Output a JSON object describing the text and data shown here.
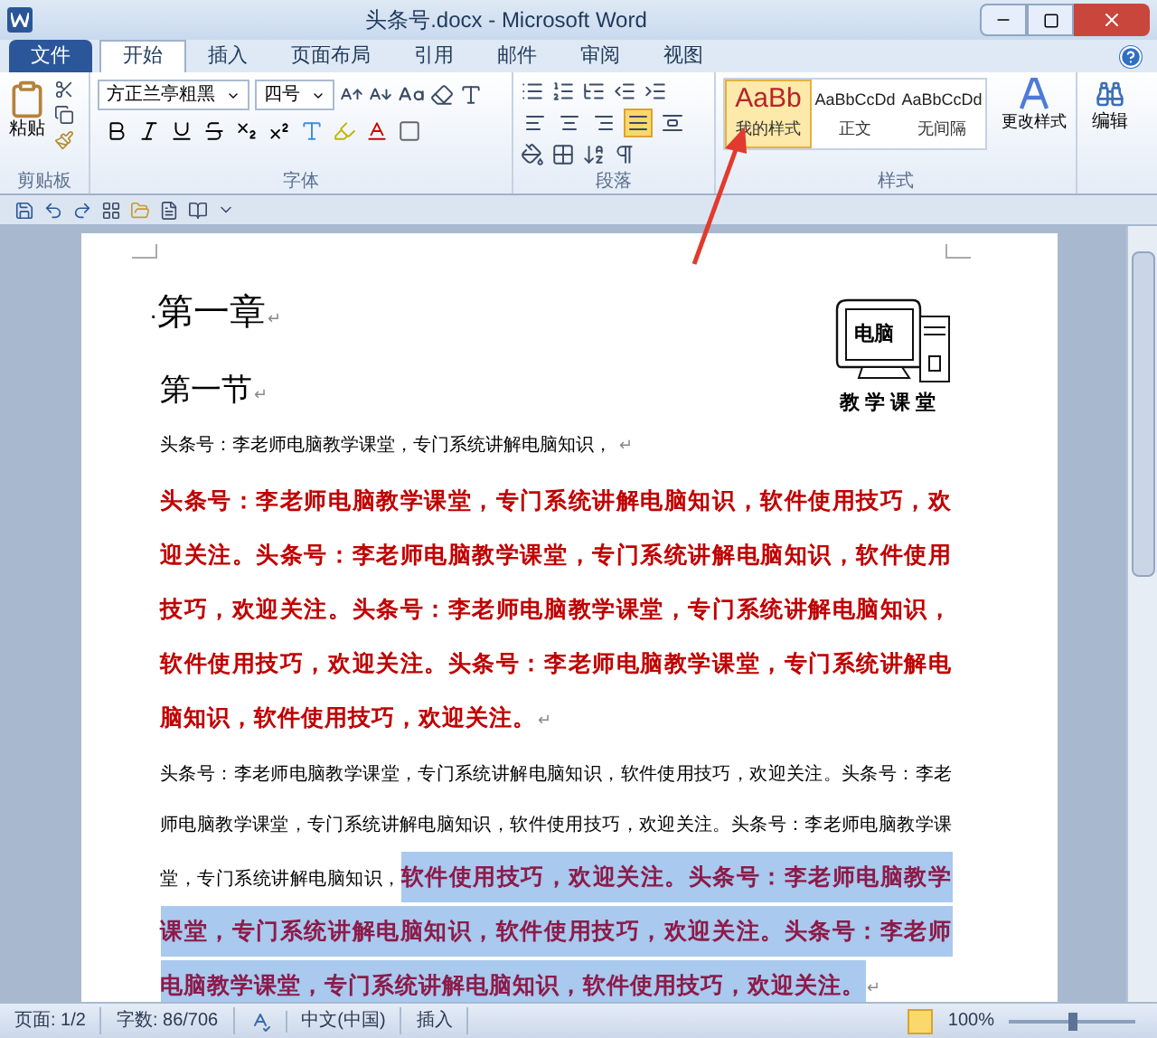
{
  "window": {
    "title": "头条号.docx - Microsoft Word"
  },
  "tabs": [
    {
      "label": "文件",
      "kind": "file",
      "selected": false
    },
    {
      "label": "开始",
      "kind": "tab",
      "selected": true
    },
    {
      "label": "插入",
      "kind": "tab",
      "selected": false
    },
    {
      "label": "页面布局",
      "kind": "tab",
      "selected": false
    },
    {
      "label": "引用",
      "kind": "tab",
      "selected": false
    },
    {
      "label": "邮件",
      "kind": "tab",
      "selected": false
    },
    {
      "label": "审阅",
      "kind": "tab",
      "selected": false
    },
    {
      "label": "视图",
      "kind": "tab",
      "selected": false
    }
  ],
  "ribbon": {
    "clipboard": {
      "paste_label": "粘贴",
      "group_label": "剪贴板"
    },
    "font": {
      "name": "方正兰亭粗黑",
      "size": "四号",
      "group_label": "字体"
    },
    "paragraph": {
      "group_label": "段落",
      "alignment": [
        {
          "selected": false
        },
        {
          "selected": false
        },
        {
          "selected": false
        },
        {
          "selected": true
        },
        {
          "selected": false
        }
      ]
    },
    "styles": {
      "group_label": "样式",
      "items": [
        {
          "sample": "AaBb",
          "name": "我的样式",
          "kind": "custom",
          "selected": true
        },
        {
          "sample": "AaBbCcDd",
          "name": "正文",
          "kind": "builtin",
          "selected": false
        },
        {
          "sample": "AaBbCcDd",
          "name": "无间隔",
          "kind": "builtin",
          "selected": false
        }
      ]
    },
    "change_styles": "更改样式",
    "editing": "编辑"
  },
  "document": {
    "clipart": {
      "screen_text": "电脑",
      "caption": "教学课堂"
    },
    "blocks": [
      {
        "kind": "heading1",
        "marker": "·",
        "mark": "↵",
        "segments": [
          {
            "text": "第一章",
            "kind": "plain",
            "selected": false
          }
        ]
      },
      {
        "kind": "heading2",
        "mark": "↵",
        "segments": [
          {
            "text": "第一节",
            "kind": "plain",
            "selected": false
          }
        ]
      },
      {
        "kind": "body",
        "mark": "↵",
        "segments": [
          {
            "text": "头条号：李老师电脑教学课堂，专门系统讲解电脑知识， ",
            "kind": "plain",
            "selected": false
          }
        ]
      },
      {
        "kind": "body",
        "mark": "↵",
        "segments": [
          {
            "text": "头条号：李老师电脑教学课堂，专门系统讲解电脑知识，软件使用技巧，欢迎关注。头条号：李老师电脑教学课堂，专门系统讲解电脑知识，软件使用技巧，欢迎关注。头条号：李老师电脑教学课堂，专门系统讲解电脑知识，软件使用技巧，欢迎关注。头条号：李老师电脑教学课堂，专门系统讲解电脑知识，软件使用技巧，欢迎关注。",
            "kind": "strong",
            "selected": false
          }
        ]
      },
      {
        "kind": "body",
        "mark": "↵",
        "segments": [
          {
            "text": "头条号：李老师电脑教学课堂，专门系统讲解电脑知识，软件使用技巧，欢迎关注。头条号：李老师电脑教学课堂，专门系统讲解电脑知识，软件使用技巧，欢迎关注。头条号：李老师电脑教学课堂，专门系统讲解电脑知识，",
            "kind": "plain",
            "selected": false
          },
          {
            "text": "软件使用技巧，欢迎关注。头条号：李老师电脑教学课堂，专门系统讲解电脑知识，软件使用技巧，欢迎关注。头条号：李老师电脑教学课堂，专门系统讲解电脑知识，软件使用技巧，欢迎关注。",
            "kind": "strong",
            "selected": true
          }
        ]
      }
    ]
  },
  "status_bar": {
    "page": "页面: 1/2",
    "words": "字数: 86/706",
    "language": "中文(中国)",
    "mode": "插入",
    "zoom": "100%",
    "zoom_slider": {
      "level": 0.5
    }
  }
}
